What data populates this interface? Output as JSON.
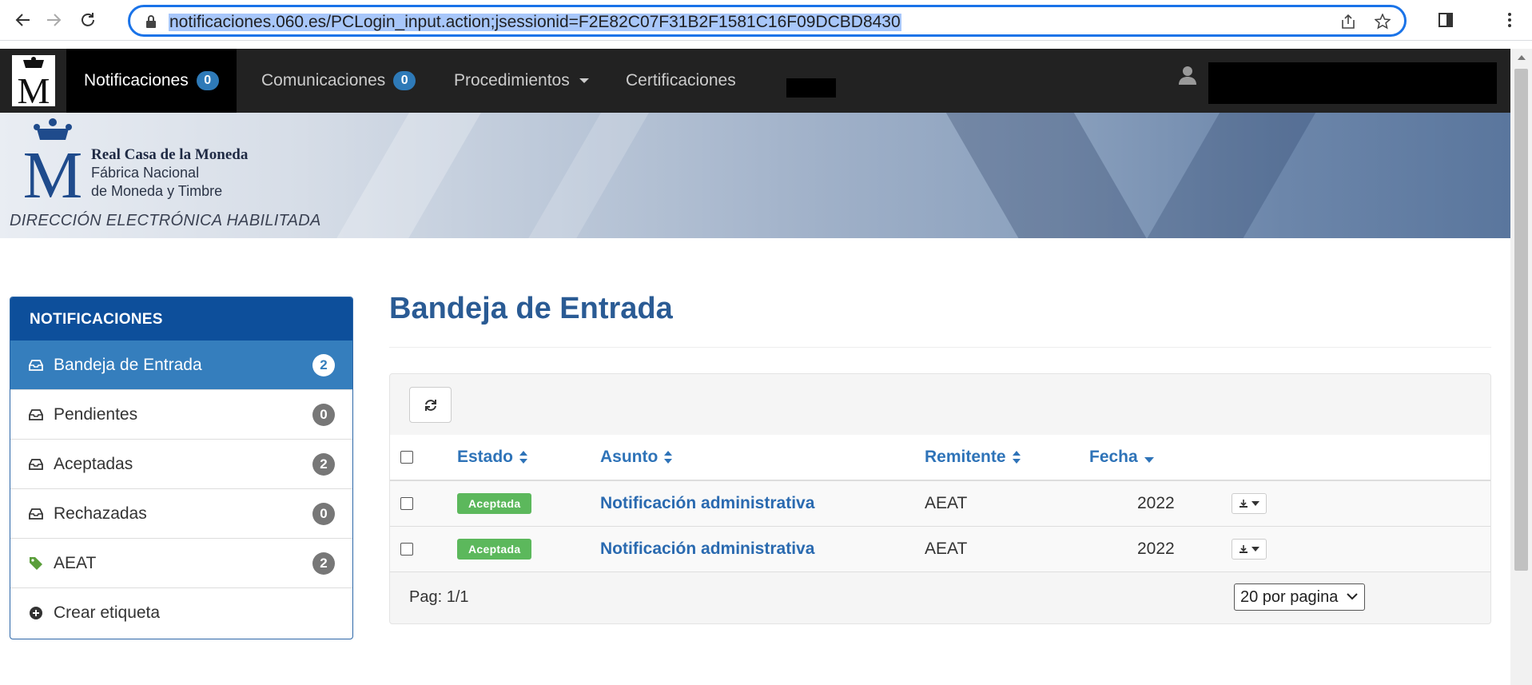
{
  "browser": {
    "url": "notificaciones.060.es/PCLogin_input.action;jsessionid=F2E82C07F31B2F1581C16F09DCBD8430"
  },
  "nav": {
    "items": [
      {
        "label": "Notificaciones",
        "badge": "0"
      },
      {
        "label": "Comunicaciones",
        "badge": "0"
      },
      {
        "label": "Procedimientos"
      },
      {
        "label": "Certificaciones"
      }
    ]
  },
  "banner": {
    "line1": "Real Casa de la Moneda",
    "line2": "Fábrica Nacional",
    "line3": "de Moneda y Timbre",
    "direccion": "DIRECCIÓN ELECTRÓNICA HABILITADA"
  },
  "sidebar": {
    "header": "NOTIFICACIONES",
    "items": [
      {
        "label": "Bandeja de Entrada",
        "badge": "2",
        "icon": "inbox-icon"
      },
      {
        "label": "Pendientes",
        "badge": "0",
        "icon": "inbox-icon"
      },
      {
        "label": "Aceptadas",
        "badge": "2",
        "icon": "inbox-icon"
      },
      {
        "label": "Rechazadas",
        "badge": "0",
        "icon": "inbox-icon"
      },
      {
        "label": "AEAT",
        "badge": "2",
        "icon": "tag-icon"
      },
      {
        "label": "Crear etiqueta",
        "icon": "plus-circle-icon"
      }
    ]
  },
  "main": {
    "title": "Bandeja de Entrada",
    "columns": {
      "estado": "Estado",
      "asunto": "Asunto",
      "remitente": "Remitente",
      "fecha": "Fecha"
    },
    "rows": [
      {
        "estado": "Aceptada",
        "asunto": "Notificación administrativa",
        "remitente": "AEAT",
        "fecha": "2022"
      },
      {
        "estado": "Aceptada",
        "asunto": "Notificación administrativa",
        "remitente": "AEAT",
        "fecha": "2022"
      }
    ],
    "pagination": "Pag: 1/1",
    "per_page": "20 por pagina"
  },
  "colors": {
    "accent": "#357ebd",
    "header": "#0d4f9b",
    "success": "#5cb85c",
    "navbar": "#222222"
  }
}
